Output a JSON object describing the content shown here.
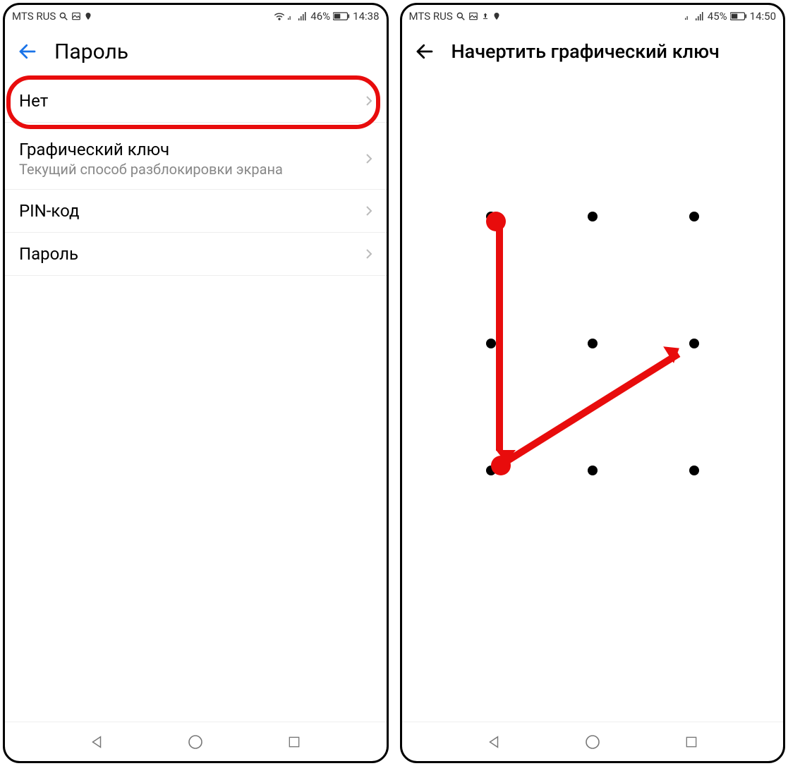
{
  "left": {
    "status": {
      "carrier": "MTS RUS",
      "battery": "46%",
      "time": "14:38"
    },
    "header": {
      "title": "Пароль"
    },
    "items": [
      {
        "label": "Нет",
        "sublabel": ""
      },
      {
        "label": "Графический ключ",
        "sublabel": "Текущий способ разблокировки экрана"
      },
      {
        "label": "PIN-код",
        "sublabel": ""
      },
      {
        "label": "Пароль",
        "sublabel": ""
      }
    ]
  },
  "right": {
    "status": {
      "carrier": "MTS RUS",
      "battery": "45%",
      "time": "14:50"
    },
    "header": {
      "title": "Начертить графический ключ"
    },
    "pattern": {
      "dots": 9,
      "path_indices": [
        0,
        6,
        5
      ],
      "note": "pattern goes top-left → bottom-left → middle-right"
    }
  },
  "icons": {
    "search": "search-icon",
    "image": "image-icon",
    "upload": "upload-icon",
    "location": "location-icon",
    "wifi": "wifi-icon",
    "signal": "signal-icon",
    "battery": "battery-icon",
    "back_arrow": "back-arrow-icon",
    "chevron_right": "chevron-right-icon",
    "nav_back": "nav-back-icon",
    "nav_home": "nav-home-icon",
    "nav_recent": "nav-recent-icon"
  }
}
